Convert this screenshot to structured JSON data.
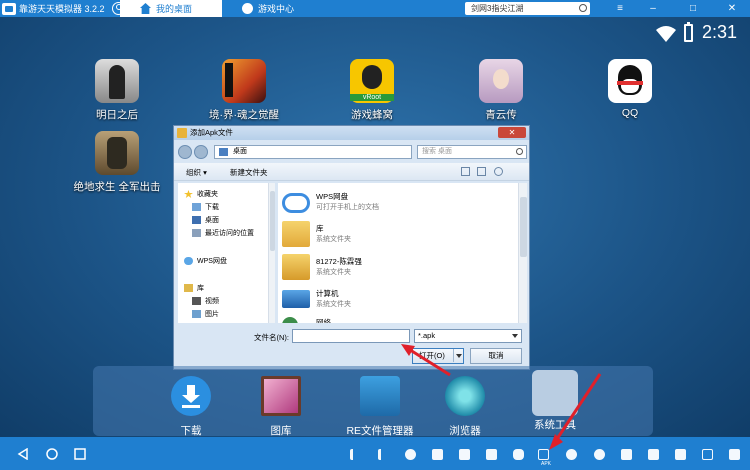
{
  "topbar": {
    "app_title": "靠游天天模拟器 3.2.2",
    "tabs": [
      {
        "label": "我的桌面",
        "active": true
      },
      {
        "label": "游戏中心",
        "active": false
      }
    ],
    "search_value": "剑网3指尖江湖",
    "window_buttons": [
      "≡",
      "–",
      "□",
      "✕"
    ]
  },
  "statusbar": {
    "clock": "2:31"
  },
  "desktop_apps": [
    {
      "label": "明日之后",
      "icon": "mingrizhihou-icon"
    },
    {
      "label": "境·界·魂之觉醒",
      "icon": "bleach-icon"
    },
    {
      "label": "游戏蜂窝",
      "icon": "youxifengwo-icon",
      "badge": "vRoot"
    },
    {
      "label": "青云传",
      "icon": "qingyunzhuan-icon"
    },
    {
      "label": "QQ",
      "icon": "qq-icon"
    },
    {
      "label": "绝地求生 全军出击",
      "icon": "pubg-icon"
    }
  ],
  "dialog": {
    "title": "添加Apk文件",
    "close_label": "✕",
    "address": "桌面",
    "search_placeholder": "搜索 桌面",
    "toolbar": {
      "organize": "组织 ▾",
      "new_folder": "新建文件夹"
    },
    "nav": {
      "favorites_header": "收藏夹",
      "favorites": [
        "下载",
        "桌面",
        "最近访问的位置"
      ],
      "wps": "WPS网盘",
      "library_header": "库",
      "library": [
        "视频",
        "图片"
      ]
    },
    "files": [
      {
        "name": "WPS网盘",
        "sub": "可打开手机上的文档"
      },
      {
        "name": "库",
        "sub": "系统文件夹"
      },
      {
        "name": "81272-陈霖强",
        "sub": "系统文件夹"
      },
      {
        "name": "计算机",
        "sub": "系统文件夹"
      },
      {
        "name": "网络",
        "sub": ""
      }
    ],
    "filename_label": "文件名(N):",
    "filename_value": "",
    "filetype_value": "*.apk",
    "open_label": "打开(O)",
    "cancel_label": "取消"
  },
  "dock": [
    {
      "label": "下载",
      "icon": "download-icon"
    },
    {
      "label": "图库",
      "icon": "gallery-icon"
    },
    {
      "label": "RE文件管理器",
      "icon": "re-file-manager-icon"
    },
    {
      "label": "浏览器",
      "icon": "browser-icon"
    },
    {
      "label": "系统工具",
      "icon": "system-tools-folder-icon"
    }
  ],
  "navbar": {
    "apk_label": "APK"
  },
  "colors": {
    "primary_blue": "#1f7fd0",
    "dialog_bg": "#d9e6f4",
    "arrow_red": "#e0202a"
  }
}
